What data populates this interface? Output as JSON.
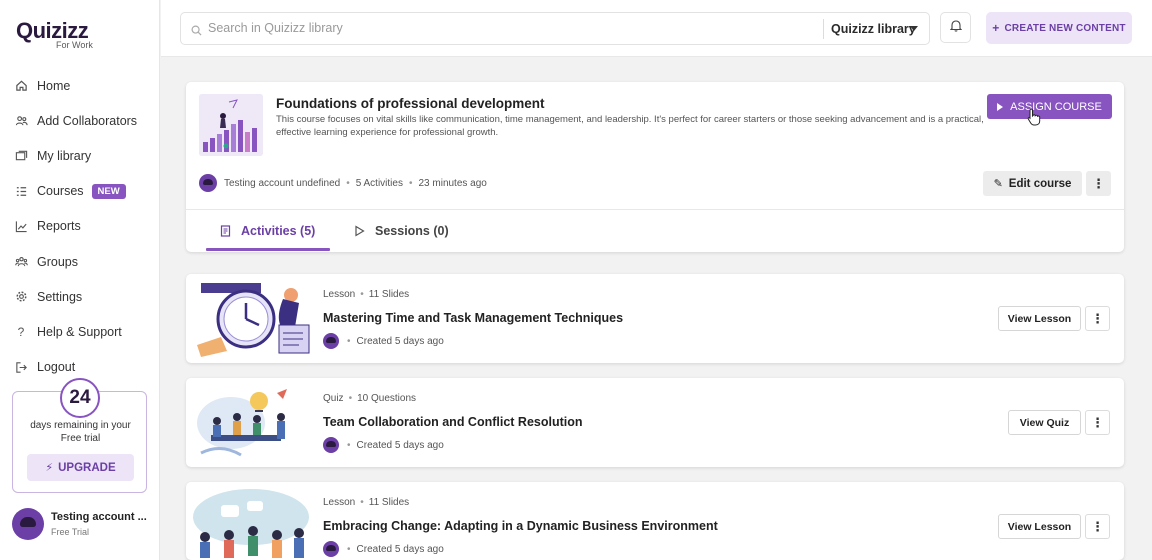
{
  "brand": {
    "name": "Quizizz",
    "subtitle": "For Work",
    "accent": "#8854c0",
    "accent_light": "#ede4f7"
  },
  "sidebar": {
    "items": [
      {
        "label": "Home",
        "icon": "home-icon"
      },
      {
        "label": "Add Collaborators",
        "icon": "collaborators-icon"
      },
      {
        "label": "My library",
        "icon": "library-icon"
      },
      {
        "label": "Courses",
        "icon": "courses-icon",
        "badge": "NEW"
      },
      {
        "label": "Reports",
        "icon": "reports-icon"
      },
      {
        "label": "Groups",
        "icon": "groups-icon"
      },
      {
        "label": "Settings",
        "icon": "settings-icon"
      },
      {
        "label": "Help & Support",
        "icon": "help-icon"
      },
      {
        "label": "Logout",
        "icon": "logout-icon"
      }
    ],
    "trial": {
      "days": "24",
      "text_line1": "days remaining in your",
      "text_line2": "Free trial",
      "upgrade_label": "UPGRADE"
    },
    "user": {
      "name": "Testing account ...",
      "plan": "Free Trial"
    }
  },
  "topbar": {
    "search_placeholder": "Search in Quizizz library",
    "library_select": "Quizizz library",
    "create_label": "CREATE NEW CONTENT"
  },
  "course": {
    "title": "Foundations of professional development",
    "description": "This course focuses on vital skills like communication, time management, and leadership. It's perfect for career starters or those seeking advancement and is a practical, effective learning experience for professional growth.",
    "assign_label": "ASSIGN COURSE",
    "author": "Testing account undefined",
    "activities_count": "5 Activities",
    "updated": "23 minutes ago",
    "edit_label": "Edit course",
    "tabs": [
      {
        "label": "Activities (5)"
      },
      {
        "label": "Sessions (0)"
      }
    ]
  },
  "activities": [
    {
      "type": "Lesson",
      "count": "11 Slides",
      "title": "Mastering Time and Task Management Techniques",
      "created": "Created 5 days ago",
      "action": "View Lesson"
    },
    {
      "type": "Quiz",
      "count": "10 Questions",
      "title": "Team Collaboration and Conflict Resolution",
      "created": "Created 5 days ago",
      "action": "View Quiz"
    },
    {
      "type": "Lesson",
      "count": "11 Slides",
      "title": "Embracing Change: Adapting in a Dynamic Business Environment",
      "created": "Created 5 days ago",
      "action": "View Lesson"
    }
  ]
}
